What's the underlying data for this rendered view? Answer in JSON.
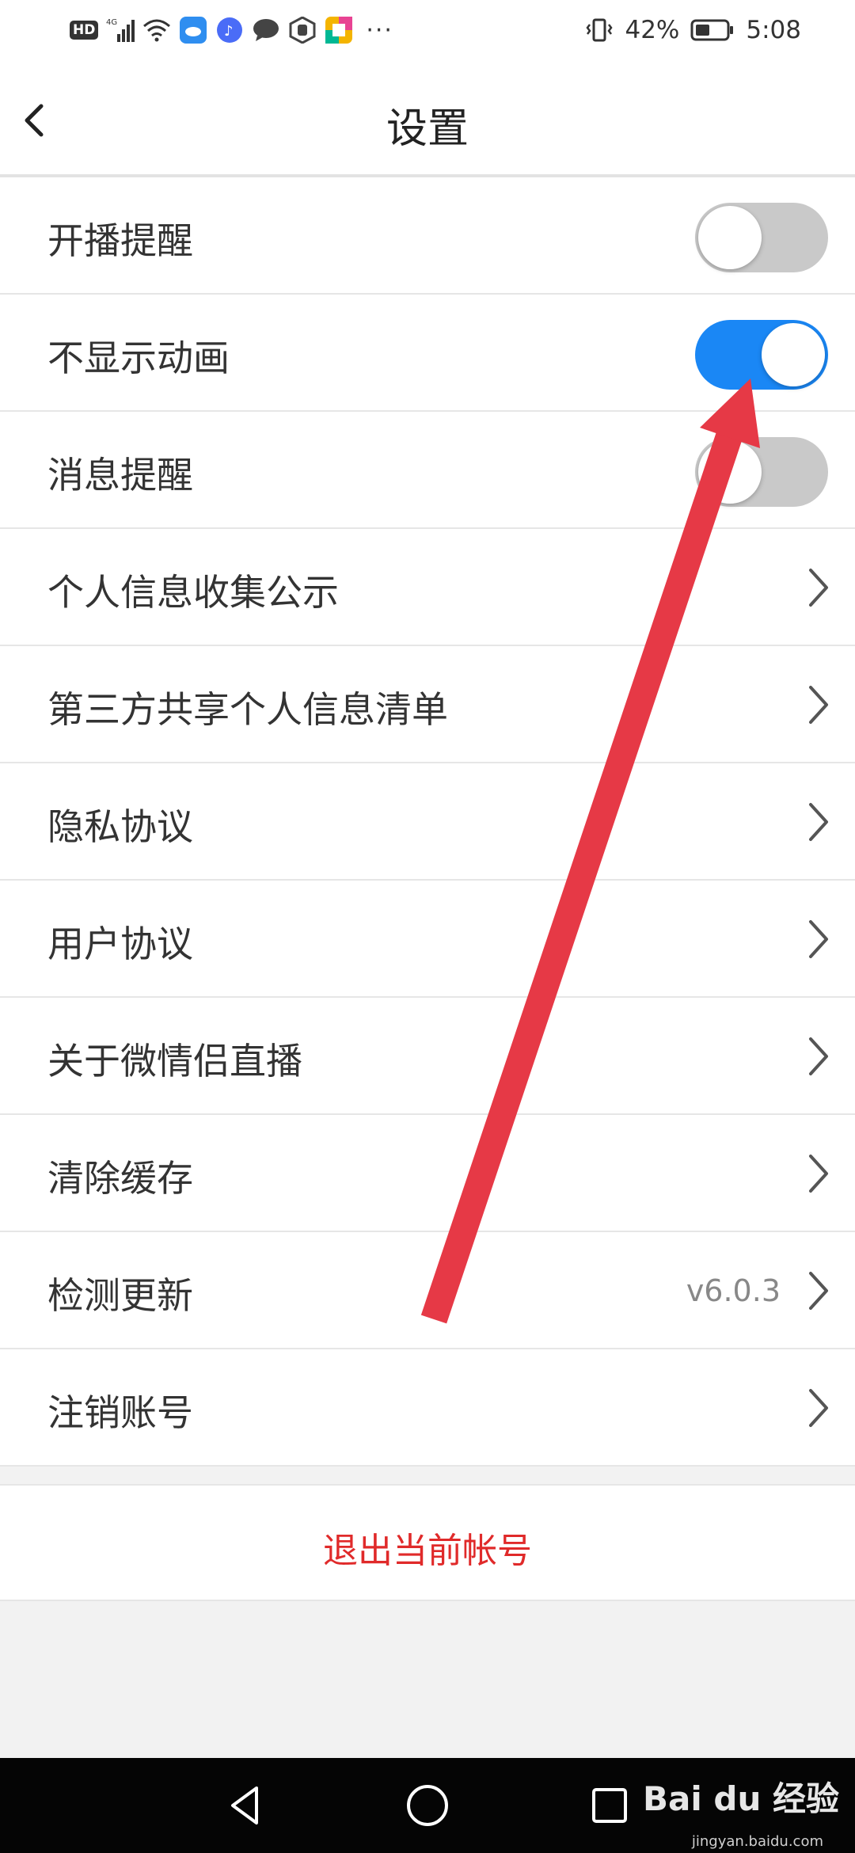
{
  "status_bar": {
    "hd": "HD",
    "network": "4G",
    "battery_percent": "42%",
    "time": "5:08",
    "more": "···"
  },
  "header": {
    "title": "设置"
  },
  "rows": [
    {
      "label": "开播提醒",
      "type": "toggle",
      "on": false
    },
    {
      "label": "不显示动画",
      "type": "toggle",
      "on": true
    },
    {
      "label": "消息提醒",
      "type": "toggle",
      "on": false
    },
    {
      "label": "个人信息收集公示",
      "type": "link"
    },
    {
      "label": "第三方共享个人信息清单",
      "type": "link"
    },
    {
      "label": "隐私协议",
      "type": "link"
    },
    {
      "label": "用户协议",
      "type": "link"
    },
    {
      "label": "关于微情侣直播",
      "type": "link"
    },
    {
      "label": "清除缓存",
      "type": "link"
    },
    {
      "label": "检测更新",
      "type": "link",
      "value": "v6.0.3"
    },
    {
      "label": "注销账号",
      "type": "link"
    }
  ],
  "logout": {
    "label": "退出当前帐号"
  },
  "watermark": {
    "brand": "Bai du 经验",
    "url": "jingyan.baidu.com"
  },
  "colors": {
    "toggle_on": "#1a87f5",
    "toggle_off": "#c9c9c9",
    "logout_text": "#e02a2a",
    "annotation_arrow": "#e63946"
  }
}
